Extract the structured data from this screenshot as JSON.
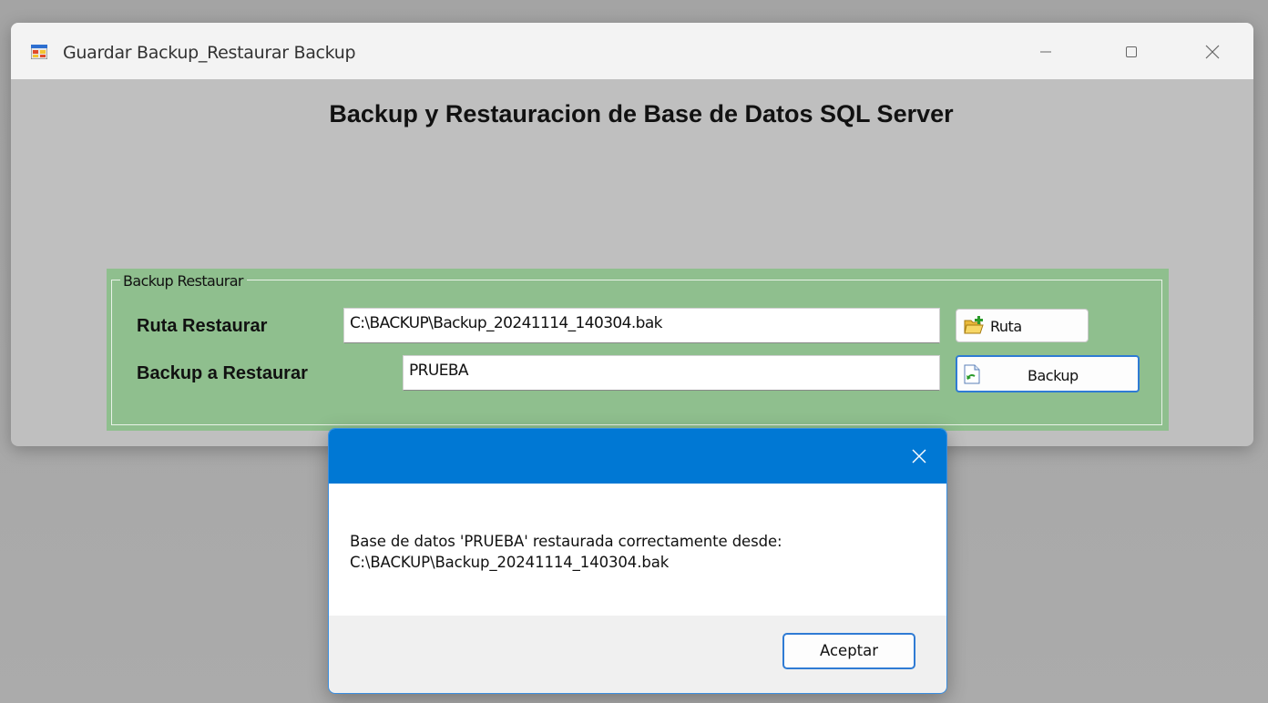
{
  "window": {
    "title": "Guardar Backup_Restaurar Backup",
    "app_icon": "windows-form-icon"
  },
  "main": {
    "heading": "Backup y Restauracion de Base de Datos SQL Server"
  },
  "group": {
    "legend": "Backup Restaurar",
    "ruta_label": "Ruta Restaurar",
    "ruta_value": "C:\\BACKUP\\Backup_20241114_140304.bak",
    "backup_label": "Backup a Restaurar",
    "backup_value": "PRUEBA",
    "ruta_button": "Ruta",
    "ruta_button_icon": "folder-add-icon",
    "backup_button": "Backup",
    "backup_button_icon": "document-restore-icon"
  },
  "dialog": {
    "message_line1": "Base de datos 'PRUEBA' restaurada correctamente desde:",
    "message_line2": "C:\\BACKUP\\Backup_20241114_140304.bak",
    "ok_label": "Aceptar",
    "accent_color": "#0078d4"
  }
}
